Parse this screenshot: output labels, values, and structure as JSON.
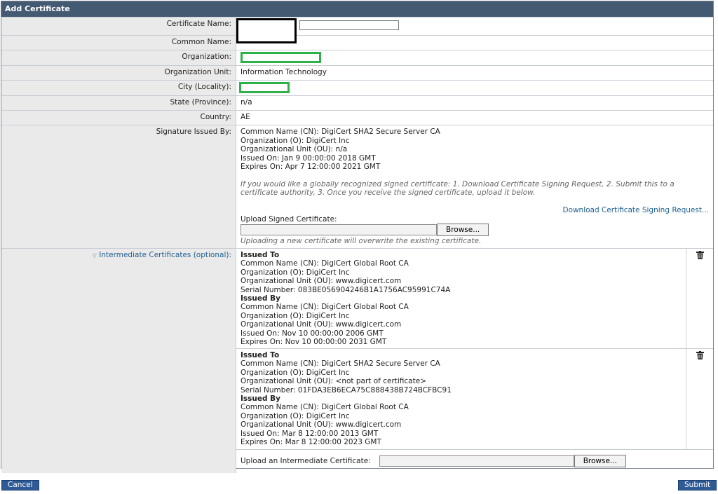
{
  "title": "Add Certificate",
  "fields": {
    "certificate_name_label": "Certificate Name:",
    "common_name_label": "Common Name:",
    "organization_label": "Organization:",
    "organization_unit_label": "Organization Unit:",
    "organization_unit_value": "Information Technology",
    "city_label": "City (Locality):",
    "state_label": "State (Province):",
    "state_value": "n/a",
    "country_label": "Country:",
    "country_value": "AE",
    "signature_label": "Signature Issued By:"
  },
  "signature": {
    "lines": [
      "Common Name (CN): DigiCert SHA2 Secure Server CA",
      "Organization (O): DigiCert Inc",
      "Organizational Unit (OU): n/a",
      "Issued On: Jan 9 00:00:00 2018 GMT",
      "Expires On: Apr 7 12:00:00 2021 GMT"
    ],
    "note": "If you would like a globally recognized signed certificate: 1. Download Certificate Signing Request, 2. Submit this to a certificate authority, 3. Once you receive the signed certificate, upload it below.",
    "download_link": "Download Certificate Signing Request...",
    "upload_label": "Upload Signed Certificate:",
    "browse_label": "Browse...",
    "upload_note": "Uploading a new certificate will overwrite the existing certificate."
  },
  "intermediate": {
    "label": "Intermediate Certificates (optional):",
    "certs": [
      {
        "issued_to_title": "Issued To",
        "issued_to": [
          "Common Name (CN): DigiCert Global Root CA",
          "Organization (O): DigiCert Inc",
          "Organizational Unit (OU): www.digicert.com",
          "Serial Number: 083BE056904246B1A1756AC95991C74A"
        ],
        "issued_by_title": "Issued By",
        "issued_by": [
          "Common Name (CN): DigiCert Global Root CA",
          "Organization (O): DigiCert Inc",
          "Organizational Unit (OU): www.digicert.com",
          "Issued On: Nov 10 00:00:00 2006 GMT",
          "Expires On: Nov 10 00:00:00 2031 GMT"
        ]
      },
      {
        "issued_to_title": "Issued To",
        "issued_to": [
          "Common Name (CN): DigiCert SHA2 Secure Server CA",
          "Organization (O): DigiCert Inc",
          "Organizational Unit (OU): <not part of certificate>",
          "Serial Number: 01FDA3EB6ECA75C888438B724BCFBC91"
        ],
        "issued_by_title": "Issued By",
        "issued_by": [
          "Common Name (CN): DigiCert Global Root CA",
          "Organization (O): DigiCert Inc",
          "Organizational Unit (OU): www.digicert.com",
          "Issued On: Mar 8 12:00:00 2013 GMT",
          "Expires On: Mar 8 12:00:00 2023 GMT"
        ]
      }
    ],
    "upload_label": "Upload an Intermediate Certificate:",
    "browse_label": "Browse..."
  },
  "buttons": {
    "cancel": "Cancel",
    "submit": "Submit"
  },
  "colors": {
    "header": "#445a73",
    "button": "#2e5a96",
    "redaction_green": "#2fb14a",
    "label_bg": "#eaeaea"
  }
}
